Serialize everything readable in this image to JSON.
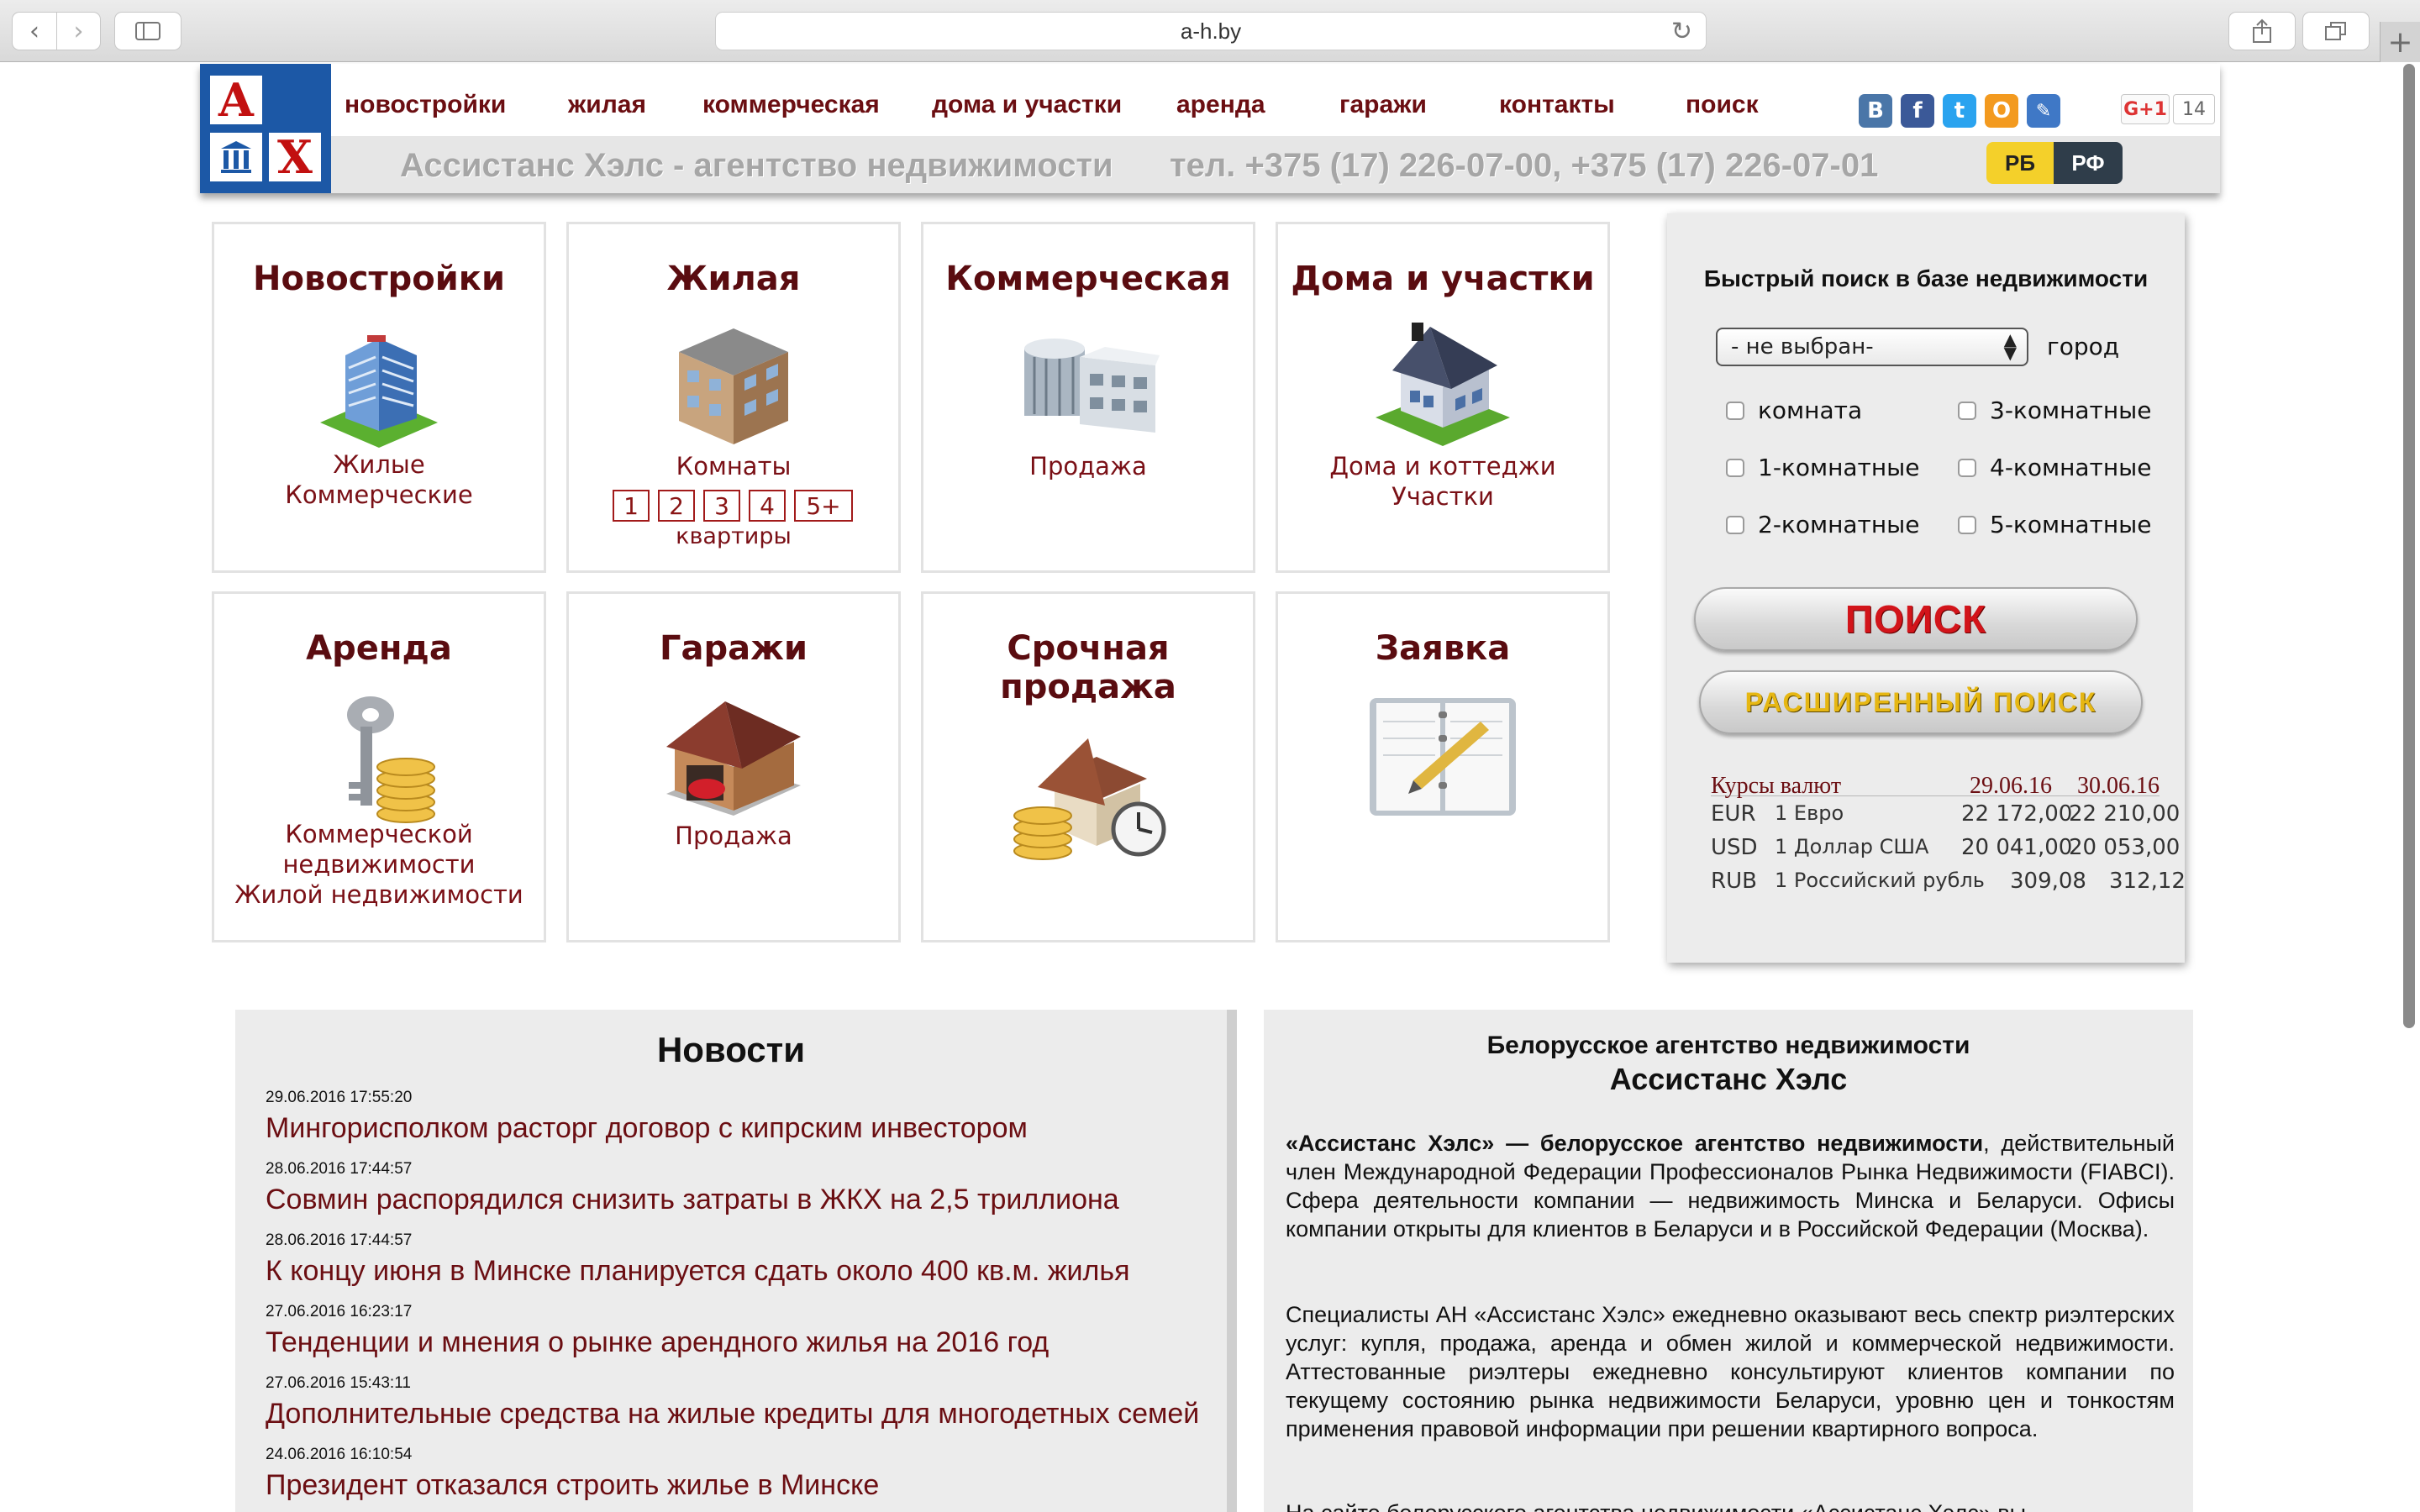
{
  "browser": {
    "url": "a-h.by"
  },
  "nav": {
    "items": [
      "новостройки",
      "жилая",
      "коммерческая",
      "дома и участки",
      "аренда",
      "гаражи",
      "контакты",
      "поиск"
    ]
  },
  "logo": {
    "letters": [
      "А",
      "Х"
    ]
  },
  "social": {
    "vk": "В",
    "fb": "f",
    "tw": "t",
    "ok": "О",
    "gplus_label": "G+1",
    "gplus_count": "14",
    "colors": {
      "vk": "#4a76a8",
      "fb": "#3b5998",
      "tw": "#2aa3ef",
      "ok": "#f39a1f",
      "link": "#3f78c6"
    }
  },
  "header": {
    "tagline": "Ассистанс Хэлс - агентство недвижимости",
    "phones": "тел. +375 (17) 226-07-00, +375 (17) 226-07-01",
    "country_rb": "РБ",
    "country_rf": "РФ"
  },
  "tiles": [
    {
      "title": "Новостройки",
      "links": [
        "Жилые",
        "Коммерческие"
      ],
      "icon": "building-icon"
    },
    {
      "title": "Жилая",
      "links": [
        "Комнаты"
      ],
      "rooms": [
        "1",
        "2",
        "3",
        "4",
        "5+"
      ],
      "rooms_caption": "квартиры",
      "icon": "house-block-icon"
    },
    {
      "title": "Коммерческая",
      "links": [
        "Продажа"
      ],
      "icon": "office-icon"
    },
    {
      "title": "Дома и участки",
      "links": [
        "Дома и коттеджи",
        "Участки"
      ],
      "icon": "cottage-icon"
    },
    {
      "title": "Аренда",
      "links": [
        "Коммерческой",
        "недвижимости",
        "Жилой недвижимости"
      ],
      "icon": "key-coins-icon"
    },
    {
      "title": "Гаражи",
      "links": [
        "Продажа"
      ],
      "icon": "garage-icon"
    },
    {
      "title": "Срочная продажа",
      "links": [],
      "icon": "house-coins-clock-icon"
    },
    {
      "title": "Заявка",
      "links": [],
      "icon": "notebook-icon"
    }
  ],
  "search": {
    "heading": "Быстрый поиск в базе недвижимости",
    "city_value": "- не выбран-",
    "city_label": "город",
    "checks": [
      "комната",
      "3-комнатные",
      "1-комнатные",
      "4-комнатные",
      "2-комнатные",
      "5-комнатные"
    ],
    "find_label": "ПОИСК",
    "advanced_label": "РАСШИРЕННЫЙ ПОИСК"
  },
  "rates": {
    "title": "Курсы валют",
    "date1": "29.06.16",
    "date2": "30.06.16",
    "rows": [
      {
        "code": "EUR",
        "name": "1 Евро",
        "v1": "22 172,00",
        "v2": "22 210,00"
      },
      {
        "code": "USD",
        "name": "1 Доллар США",
        "v1": "20 041,00",
        "v2": "20 053,00"
      },
      {
        "code": "RUB",
        "name": "1 Российский рубль",
        "v1": "309,08",
        "v2": "312,12"
      }
    ]
  },
  "news": {
    "heading": "Новости",
    "items": [
      {
        "date": "29.06.2016 17:55:20",
        "title": "Мингорисполком расторг договор с кипрским инвестором"
      },
      {
        "date": "28.06.2016 17:44:57",
        "title": "Совмин распорядился снизить затраты в ЖКХ на 2,5 триллиона"
      },
      {
        "date": "28.06.2016 17:44:57",
        "title": "К концу июня в Минске планируется сдать около 400 кв.м. жилья"
      },
      {
        "date": "27.06.2016 16:23:17",
        "title": "Тенденции и мнения о рынке арендного жилья на 2016 год"
      },
      {
        "date": "27.06.2016 15:43:11",
        "title": "Дополнительные средства на жилые кредиты для многодетных семей"
      },
      {
        "date": "24.06.2016 16:10:54",
        "title": "Президент отказался строить жилье в Минске"
      }
    ]
  },
  "about": {
    "heading1": "Белорусское агентство недвижимости",
    "heading2": "Ассистанс Хэлс",
    "p1_bold": "«Ассистанс Хэлс» — белорусское агентство недвижимости",
    "p1_rest": ", действительный член Международной Федерации Профессионалов Рынка Недвижимости (FIABCI). Сфера деятельности компании — недвижимость Минска и Беларуси. Офисы компании открыты для клиентов в Беларуси и в Российской Федерации (Москва).",
    "p2": "Специалисты АН «Ассистанс Хэлс» ежедневно оказывают весь спектр риэлтерских услуг: купля, продажа, аренда и обмен жилой и коммерческой недвижимости. Аттестованные риэлтеры ежедневно консультируют клиентов компании по текущему состоянию рынка недвижимости Беларуси, уровню цен и тонкостям применения правовой информации при решении квартирного вопроса.",
    "p3": "На сайте белорусского агентства недвижимости «Ассистанс Хэлс» вы"
  }
}
